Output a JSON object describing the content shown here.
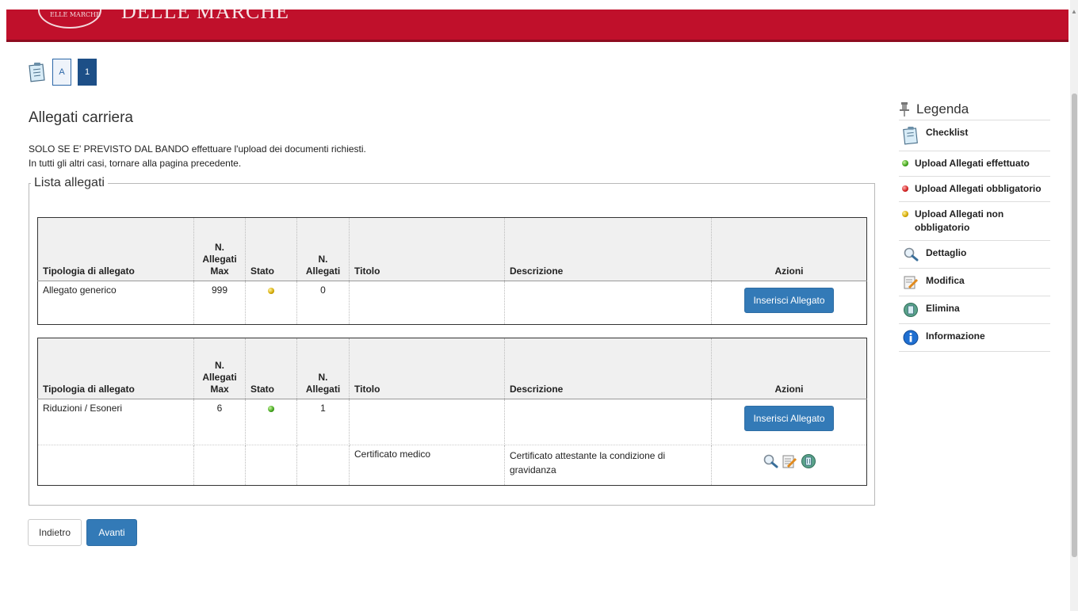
{
  "header": {
    "brand": "DELLE MARCHE",
    "seal_text": "ELLE MARCHE"
  },
  "steps": {
    "items": [
      "A",
      "1"
    ],
    "active": "1"
  },
  "page": {
    "title": "Allegati carriera",
    "intro_bold": "SOLO SE E' PREVISTO DAL BANDO",
    "intro_rest": " effettuare l'upload dei documenti richiesti.",
    "intro_line2": "In tutti gli altri casi, tornare alla pagina precedente."
  },
  "fieldset": {
    "legend": "Lista allegati"
  },
  "table_headers": {
    "tipologia": "Tipologia di allegato",
    "max_l1": "N.",
    "max_l2": "Allegati",
    "max_l3": "Max",
    "stato": "Stato",
    "n_l1": "N.",
    "n_l2": "Allegati",
    "titolo": "Titolo",
    "descrizione": "Descrizione",
    "azioni": "Azioni"
  },
  "tables": [
    {
      "rows": [
        {
          "tipologia": "Allegato generico",
          "max": "999",
          "stato": "yellow",
          "n": "0",
          "titolo": "",
          "descrizione": "",
          "action": "Inserisci Allegato"
        }
      ]
    },
    {
      "rows": [
        {
          "tipologia": "Riduzioni / Esoneri",
          "max": "6",
          "stato": "green",
          "n": "1",
          "titolo": "",
          "descrizione": "",
          "action": "Inserisci Allegato"
        }
      ],
      "attachments": [
        {
          "titolo": "Certificato medico",
          "descrizione": "Certificato attestante la condizione di gravidanza"
        }
      ]
    }
  ],
  "buttons": {
    "back": "Indietro",
    "next": "Avanti"
  },
  "legend": {
    "title": "Legenda",
    "items": [
      {
        "icon": "checklist-icon",
        "label": "Checklist"
      },
      {
        "icon": "green-dot-icon",
        "label": "Upload Allegati effettuato"
      },
      {
        "icon": "red-dot-icon",
        "label": "Upload Allegati obbligatorio"
      },
      {
        "icon": "yellow-dot-icon",
        "label": "Upload Allegati non obbligatorio"
      },
      {
        "icon": "magnifier-icon",
        "label": "Dettaglio"
      },
      {
        "icon": "edit-icon",
        "label": "Modifica"
      },
      {
        "icon": "trash-icon",
        "label": "Elimina"
      },
      {
        "icon": "info-icon",
        "label": "Informazione"
      }
    ]
  },
  "colors": {
    "header": "#c0102b",
    "primary": "#337ab7",
    "step_active": "#1d4f87"
  }
}
